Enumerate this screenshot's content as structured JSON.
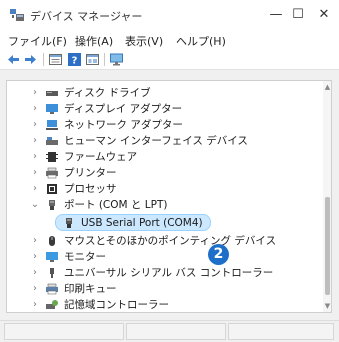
{
  "window": {
    "title": "デバイス マネージャー",
    "controls": {
      "minimize": "—",
      "maximize": "☐",
      "close": "✕"
    }
  },
  "menu": [
    {
      "label": "ファイル(F)",
      "accel": "F"
    },
    {
      "label": "操作(A)",
      "accel": "A"
    },
    {
      "label": "表示(V)",
      "accel": "V"
    },
    {
      "label": "ヘルプ(H)",
      "accel": "H"
    }
  ],
  "toolbar": {
    "buttons": [
      "back-arrow-icon",
      "forward-arrow-icon",
      "properties-icon",
      "help-icon",
      "view-icon",
      "monitor-scan-icon"
    ]
  },
  "tree": {
    "items": [
      {
        "label": "ディスク ドライブ",
        "icon": "disk-drive-icon",
        "expanded": false
      },
      {
        "label": "ディスプレイ アダプター",
        "icon": "display-adapter-icon",
        "expanded": false
      },
      {
        "label": "ネットワーク アダプター",
        "icon": "network-adapter-icon",
        "expanded": false
      },
      {
        "label": "ヒューマン インターフェイス デバイス",
        "icon": "hid-icon",
        "expanded": false
      },
      {
        "label": "ファームウェア",
        "icon": "firmware-icon",
        "expanded": false
      },
      {
        "label": "プリンター",
        "icon": "printer-icon",
        "expanded": false
      },
      {
        "label": "プロセッサ",
        "icon": "processor-icon",
        "expanded": false
      },
      {
        "label": "ポート (COM と LPT)",
        "icon": "port-icon",
        "expanded": true
      },
      {
        "label": "USB Serial Port (COM4)",
        "icon": "port-icon",
        "child": true,
        "selected": true
      },
      {
        "label": "マウスとそのほかのポインティング デバイス",
        "icon": "mouse-icon",
        "expanded": false
      },
      {
        "label": "モニター",
        "icon": "monitor-icon",
        "expanded": false
      },
      {
        "label": "ユニバーサル シリアル バス コントローラー",
        "icon": "usb-icon",
        "expanded": false
      },
      {
        "label": "印刷キュー",
        "icon": "print-queue-icon",
        "expanded": false
      },
      {
        "label": "記憶域コントローラー",
        "icon": "storage-controller-icon",
        "expanded": false
      }
    ]
  },
  "annotation": {
    "badge_number": "2"
  },
  "colors": {
    "highlight": "#cce8ff",
    "highlight_border": "#99d1ff",
    "badge": "#1e6fc8"
  }
}
